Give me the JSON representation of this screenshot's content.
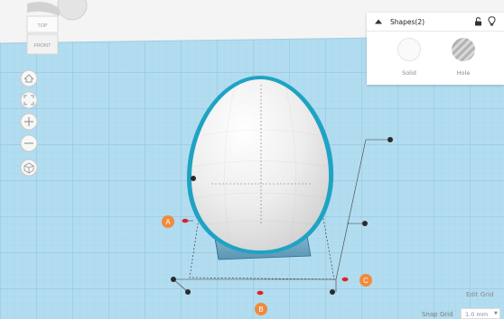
{
  "viewcube": {
    "top_label": "TOP",
    "front_label": "FRONT"
  },
  "shapes_panel": {
    "title": "Shapes(2)",
    "solid_label": "Solid",
    "hole_label": "Hole"
  },
  "handles": {
    "a_label": "A",
    "b_label": "B",
    "c_label": "C"
  },
  "grid_controls": {
    "edit_grid_label": "Edit Grid",
    "snap_grid_label": "Snap Grid",
    "snap_grid_value": "1.0 mm"
  },
  "colors": {
    "workplane": "#aed9ee",
    "grid_line": "#91c4de",
    "selection_outline": "#1fa3c4",
    "handle_dot": "#2b2b2b",
    "measure_dot": "#e02020",
    "badge": "#f08a3c"
  },
  "icons": {
    "view_controls": [
      "home-icon",
      "fit-view-icon",
      "zoom-in-icon",
      "zoom-out-icon",
      "orthographic-icon"
    ],
    "panel": [
      "collapse-arrow-icon",
      "lock-icon",
      "light-bulb-icon"
    ]
  }
}
